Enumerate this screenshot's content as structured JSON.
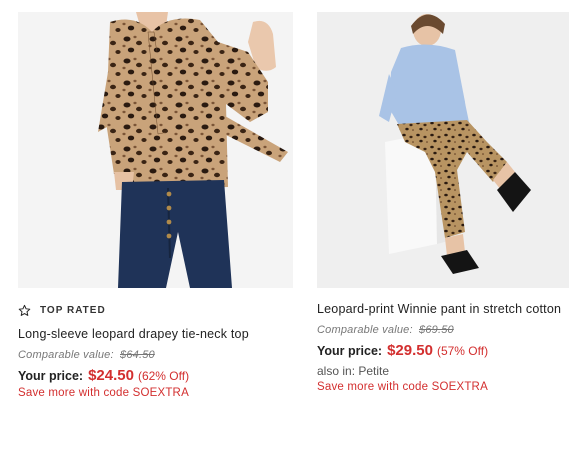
{
  "products": [
    {
      "badge": "TOP RATED",
      "title": "Long-sleeve leopard drapey tie-neck top",
      "comparable_label": "Comparable value:",
      "comparable_price": "$64.50",
      "price_label": "Your price:",
      "price": "$24.50",
      "discount": "(62% Off)",
      "promo": "Save more with code SOEXTRA"
    },
    {
      "title": "Leopard-print Winnie pant in stretch cotton",
      "comparable_label": "Comparable value:",
      "comparable_price": "$69.50",
      "price_label": "Your price:",
      "price": "$29.50",
      "discount": "(57% Off)",
      "also_in": "also in: Petite",
      "promo": "Save more with code SOEXTRA"
    }
  ],
  "colors": {
    "sale_red": "#d32f2f",
    "leopard_base": "#c9a37a",
    "denim": "#1f3358",
    "shirt_blue": "#a9c3e6"
  }
}
